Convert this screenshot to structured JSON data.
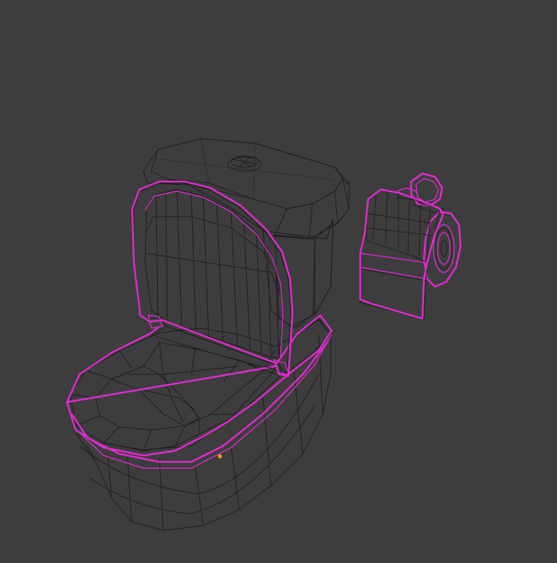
{
  "viewport": {
    "background_color": "#3d3d3d",
    "mesh_fill_color": "#8f8f8f",
    "wire_color": "#1e1e1e",
    "selection_color": "#e02bd0",
    "origin_color": "#f29a1a"
  },
  "objects": [
    {
      "id": "toilet-tank"
    },
    {
      "id": "toilet-lid-open"
    },
    {
      "id": "toilet-bowl"
    },
    {
      "id": "toilet-paper-holder"
    }
  ]
}
